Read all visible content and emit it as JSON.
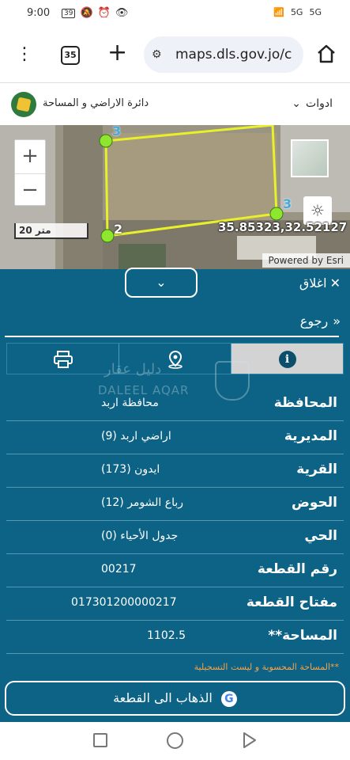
{
  "status_bar": {
    "time": "9:00",
    "battery_badge": "39",
    "signal_1": "5G",
    "signal_2": "5G"
  },
  "browser": {
    "tab_count": "35",
    "url": "maps.dls.gov.jo/c"
  },
  "app": {
    "title": "دائرة الاراضي و المساحة",
    "tools_label": "ادوات"
  },
  "map": {
    "zoom_in": "+",
    "zoom_out": "−",
    "scale_label": "20 متر",
    "coordinates": "35.85323,32.52127",
    "attribution": "Powered by Esri",
    "vertex_labels": [
      "3",
      "2",
      "3"
    ]
  },
  "panel": {
    "close_label": "اغلاق",
    "back_label": "رجوع",
    "tabs": [
      "print",
      "location",
      "info"
    ],
    "watermark_ar": "دليل عقار",
    "watermark_en": "DALEEL AQAR",
    "rows": [
      {
        "label": "المحافظة",
        "value": "محافظة اربد"
      },
      {
        "label": "المديرية",
        "value": "اراضي اربد (9)"
      },
      {
        "label": "القرية",
        "value": "ايدون (173)"
      },
      {
        "label": "الحوض",
        "value": "رباع الشومر (12)"
      },
      {
        "label": "الحي",
        "value": "جدول الأحياء (0)"
      },
      {
        "label": "رقم القطعة",
        "value": "00217"
      },
      {
        "label": "مفتاح القطعة",
        "value": "017301200000217"
      },
      {
        "label": "المساحة**",
        "value": "1102.5"
      }
    ],
    "note": "**المساحة المحسوبة و ليست التسجيلية",
    "goto_label": "الذهاب الى القطعة"
  },
  "colors": {
    "panel_bg": "#0d6385",
    "parcel_outline": "#e8f02a",
    "vertex": "#8ee62e",
    "note": "#f3a24a"
  }
}
